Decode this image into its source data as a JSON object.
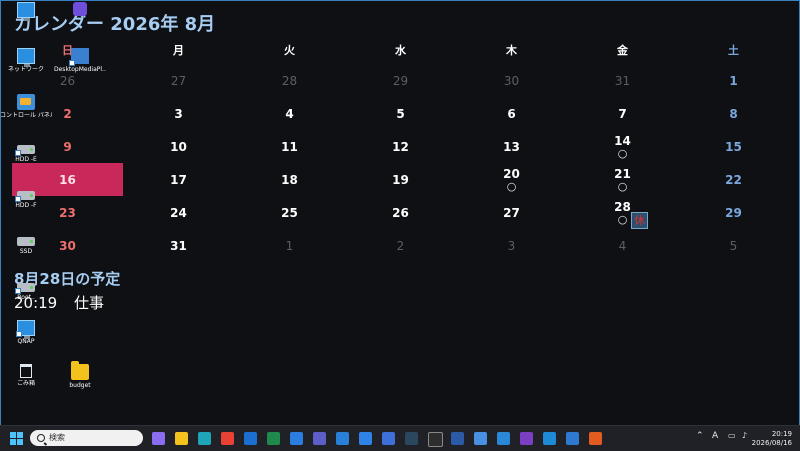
{
  "calendar": {
    "title": "カレンダー 2026年 8月",
    "weekdays": [
      "日",
      "月",
      "火",
      "水",
      "木",
      "金",
      "土"
    ],
    "weeks": [
      [
        {
          "d": "26",
          "out": true
        },
        {
          "d": "27",
          "out": true
        },
        {
          "d": "28",
          "out": true
        },
        {
          "d": "29",
          "out": true
        },
        {
          "d": "30",
          "out": true
        },
        {
          "d": "31",
          "out": true
        },
        {
          "d": "1"
        }
      ],
      [
        {
          "d": "2"
        },
        {
          "d": "3"
        },
        {
          "d": "4"
        },
        {
          "d": "5"
        },
        {
          "d": "6"
        },
        {
          "d": "7"
        },
        {
          "d": "8"
        }
      ],
      [
        {
          "d": "9"
        },
        {
          "d": "10"
        },
        {
          "d": "11"
        },
        {
          "d": "12"
        },
        {
          "d": "13"
        },
        {
          "d": "14",
          "mark": "○"
        },
        {
          "d": "15"
        }
      ],
      [
        {
          "d": "16",
          "today": true
        },
        {
          "d": "17"
        },
        {
          "d": "18"
        },
        {
          "d": "19"
        },
        {
          "d": "20",
          "mark": "○"
        },
        {
          "d": "21",
          "mark": "○"
        },
        {
          "d": "22"
        }
      ],
      [
        {
          "d": "23"
        },
        {
          "d": "24"
        },
        {
          "d": "25"
        },
        {
          "d": "26"
        },
        {
          "d": "27"
        },
        {
          "d": "28",
          "mark": "○"
        },
        {
          "d": "29"
        }
      ],
      [
        {
          "d": "30"
        },
        {
          "d": "31"
        },
        {
          "d": "1",
          "out": true
        },
        {
          "d": "2",
          "out": true
        },
        {
          "d": "3",
          "out": true
        },
        {
          "d": "4",
          "out": true
        },
        {
          "d": "5",
          "out": true
        }
      ]
    ],
    "holiday_badge": "休",
    "today_color": "#c9285a",
    "sunday_color": "#ef6f6f",
    "saturday_color": "#7aa7de"
  },
  "schedule": {
    "title": "8月28日の予定",
    "items": [
      {
        "time": "20:19",
        "text": "仕事"
      }
    ]
  },
  "desktop_icons": [
    {
      "name": "purple-app-icon",
      "label": "DesktopMediaPl..."
    },
    {
      "name": "network",
      "label": "ネットワーク"
    },
    {
      "name": "media-player",
      "label": "DesktopMediaPl..."
    },
    {
      "name": "control-panel",
      "label": "コントロール パネル"
    },
    {
      "name": "hdd-e",
      "label": "HDD -E"
    },
    {
      "name": "hdd-f",
      "label": "HDD -F"
    },
    {
      "name": "ssd",
      "label": "SSD"
    },
    {
      "name": "hdd-other",
      "label": "Boot.."
    },
    {
      "name": "qnap",
      "label": "QNAP"
    },
    {
      "name": "recycle-bin",
      "label": "ごみ箱"
    },
    {
      "name": "budget-folder",
      "label": "budget"
    }
  ],
  "taskbar": {
    "search_placeholder": "検索",
    "ime_label": "A",
    "clock_time": "20:19",
    "clock_date": "2026/08/16",
    "apps": [
      "copilot",
      "explorer",
      "edge",
      "chrome",
      "outlook",
      "excel",
      "mail",
      "teams",
      "office",
      "todo",
      "zoom",
      "steam",
      "terminal",
      "powershell",
      "mail2",
      "onedrive-cloud",
      "vs",
      "vscode",
      "security",
      "tools"
    ]
  }
}
